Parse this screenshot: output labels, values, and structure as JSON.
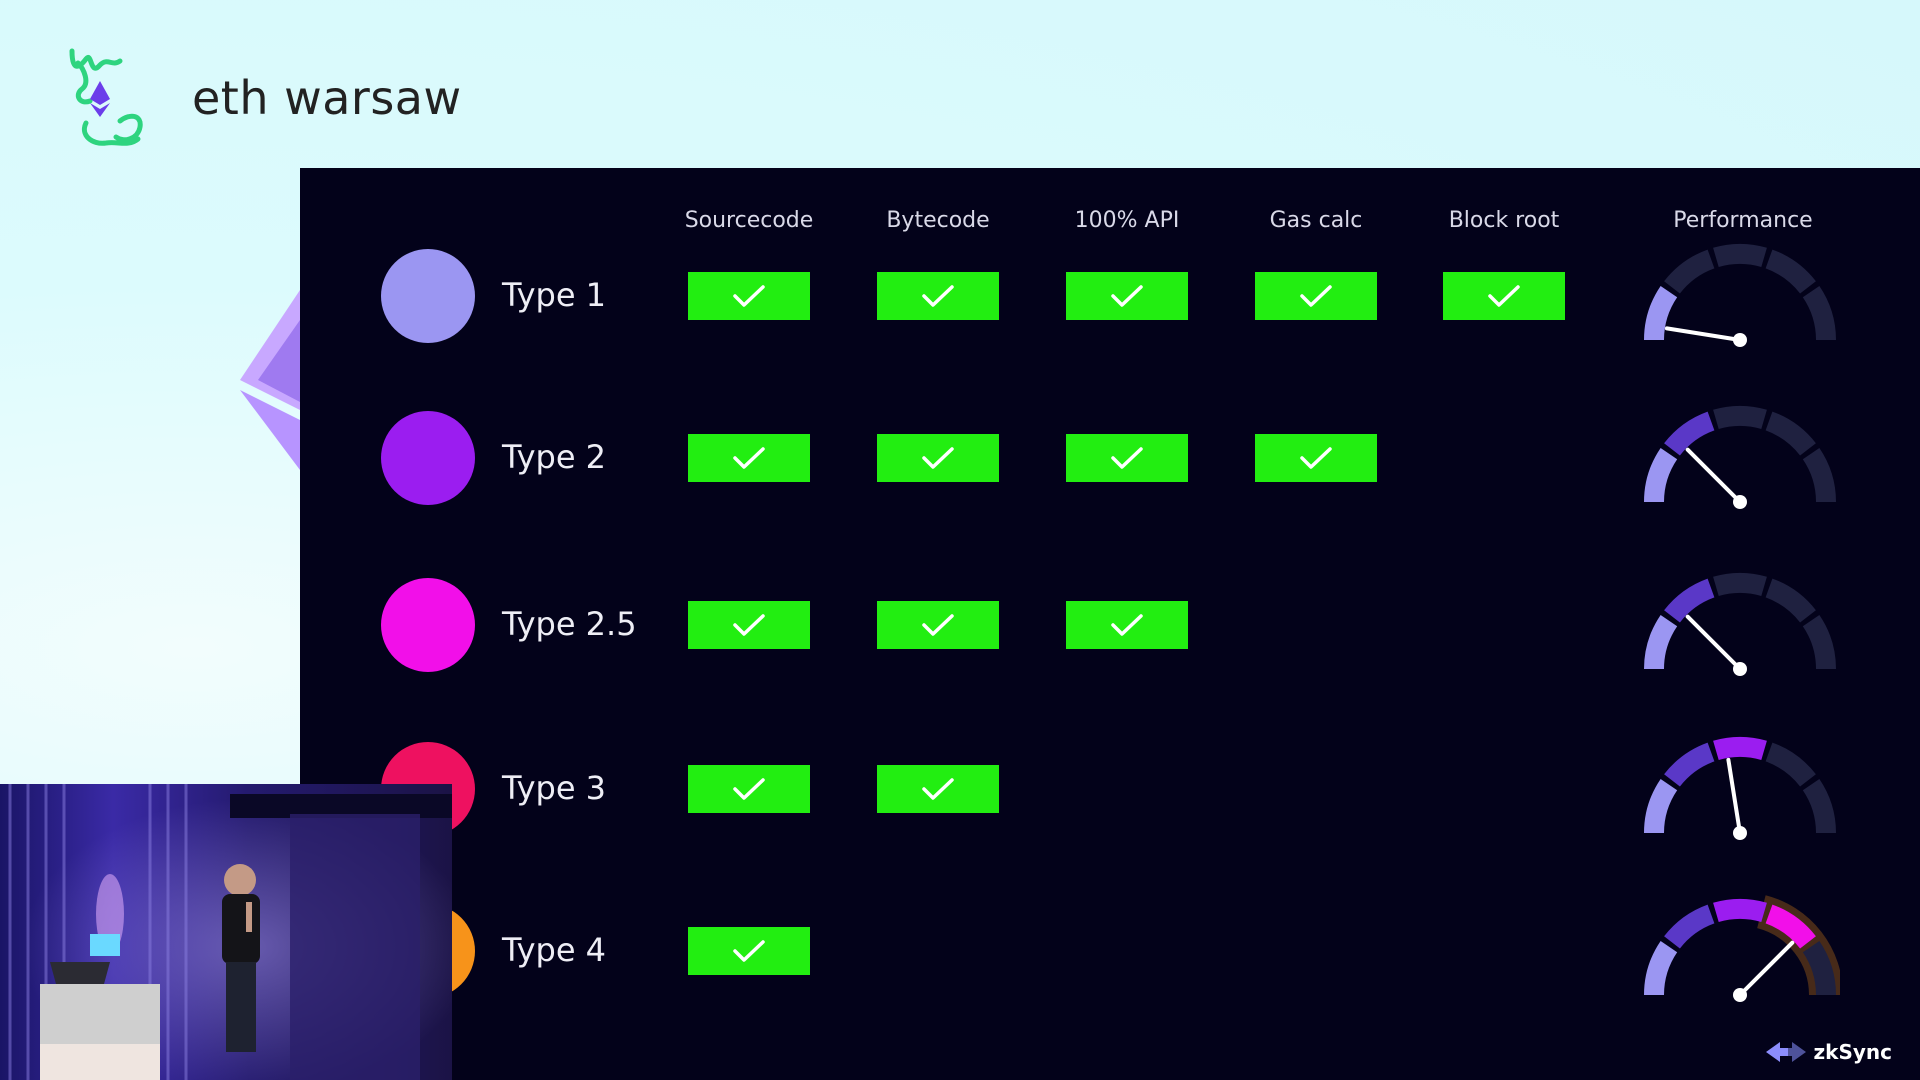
{
  "brand": {
    "name": "eth warsaw"
  },
  "columns": [
    "Sourcecode",
    "Bytecode",
    "100% API",
    "Gas calc",
    "Block root",
    "Performance"
  ],
  "rows": [
    {
      "label": "Type 1",
      "color": "#9b96f2",
      "checks": 5,
      "performance": 0.05
    },
    {
      "label": "Type 2",
      "color": "#9b1df0",
      "checks": 4,
      "performance": 0.25
    },
    {
      "label": "Type 2.5",
      "color": "#f20fe9",
      "checks": 3,
      "performance": 0.25
    },
    {
      "label": "Type 3",
      "color": "#ee1160",
      "checks": 2,
      "performance": 0.45
    },
    {
      "label": "Type 4",
      "color": "#f7931a",
      "checks": 1,
      "performance": 0.75
    }
  ],
  "colors": {
    "check": "#22ee11",
    "slide_bg": "#03021a",
    "page_bg": "#dcfbfd",
    "logo": "#2ed47f",
    "gauge_track": "#1f2140"
  },
  "icons": {
    "check": "checkmark-icon",
    "logo": "eth-warsaw-logo-icon",
    "footer": "zksync-logo-icon"
  },
  "footer": {
    "logo_text": "zkSync"
  }
}
